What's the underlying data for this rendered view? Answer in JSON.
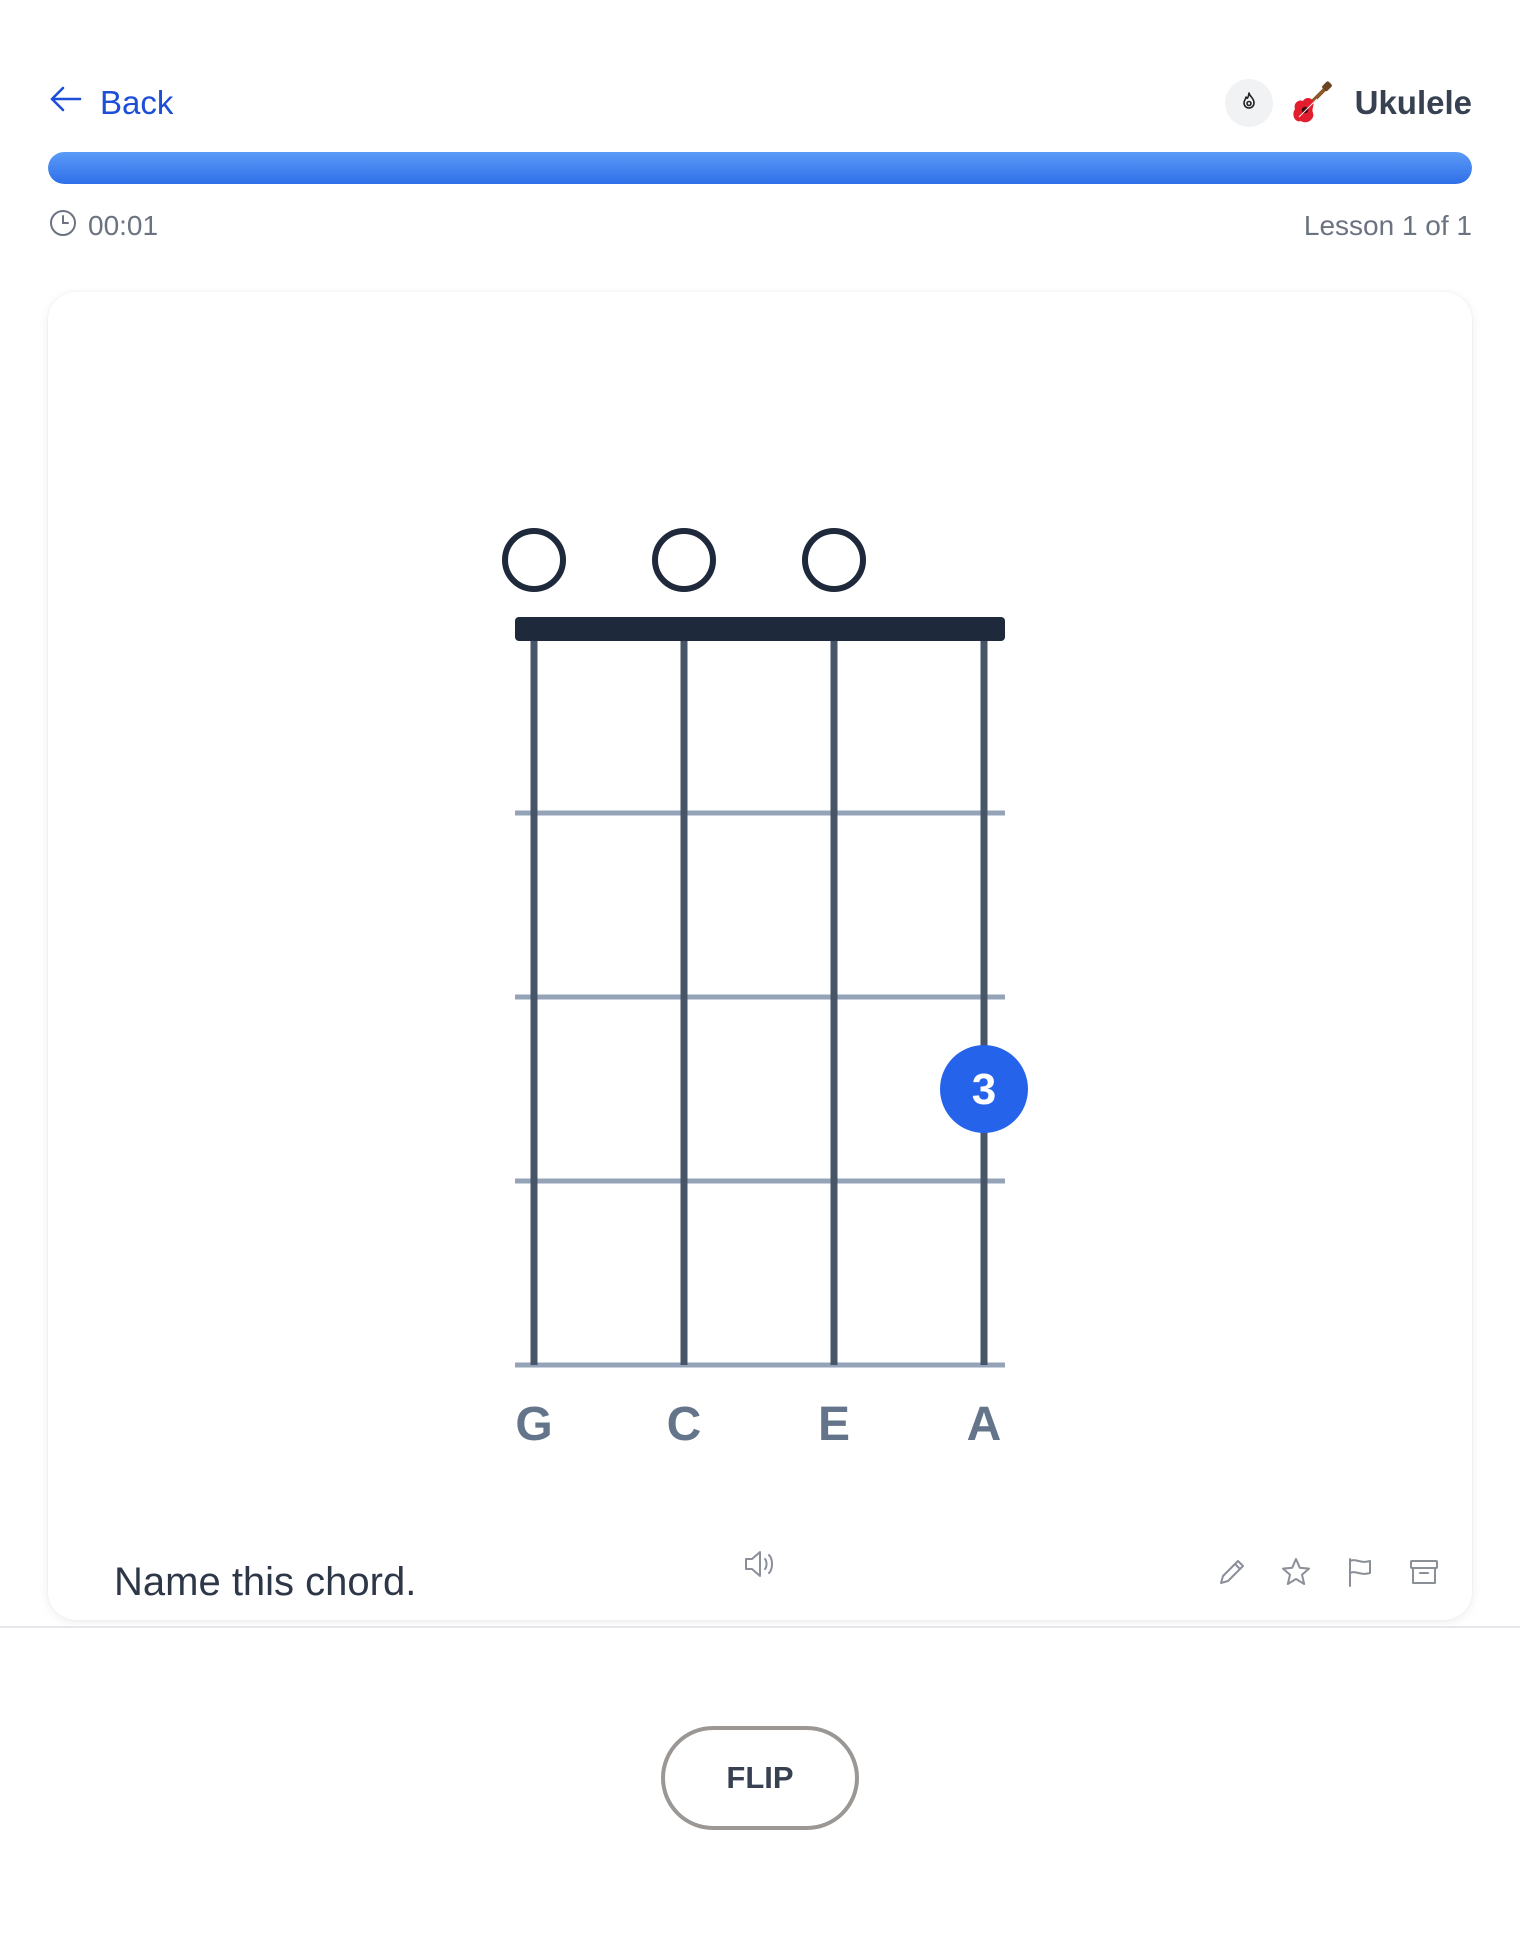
{
  "header": {
    "back_label": "Back",
    "deck_name": "Ukulele",
    "deck_icon": "guitar-icon",
    "hint_icon": "fire-icon"
  },
  "progress": {
    "value": 1.0,
    "color": "#2f6fe8"
  },
  "status": {
    "timer": "00:01",
    "lesson": "Lesson 1 of 1"
  },
  "card": {
    "chord": {
      "strings": [
        "G",
        "C",
        "E",
        "A"
      ],
      "open_strings": [
        "G",
        "C",
        "E"
      ],
      "frets_shown": 4,
      "fingers": [
        {
          "string": "A",
          "fret": 3,
          "label": "3"
        }
      ],
      "finger_color": "#2563eb"
    },
    "prompt": "Name this chord.",
    "audio_icon": "speaker-icon",
    "toolbar_icons": [
      "pencil-icon",
      "star-icon",
      "flag-icon",
      "archive-icon"
    ]
  },
  "actions": {
    "flip_label": "FLIP"
  }
}
